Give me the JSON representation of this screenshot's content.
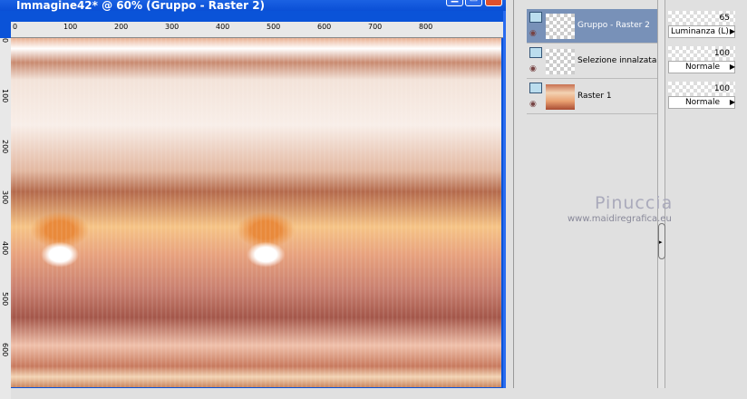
{
  "window": {
    "title": "Immagine42* @ 60% (Gruppo - Raster 2)",
    "minimize": "▁",
    "maximize": "□",
    "close": "✕"
  },
  "ruler": {
    "h_ticks": [
      "0",
      "100",
      "200",
      "300",
      "400",
      "500",
      "600",
      "700",
      "800"
    ],
    "v_ticks": [
      "0",
      "100",
      "200",
      "300",
      "400",
      "500",
      "600"
    ]
  },
  "layers": [
    {
      "name": "Gruppo - Raster 2",
      "selected": true,
      "opacity": "65",
      "blend": "Luminanza (L)"
    },
    {
      "name": "Selezione innalzata",
      "selected": false,
      "opacity": "100",
      "blend": "Normale"
    },
    {
      "name": "Raster 1",
      "selected": false,
      "opacity": "100",
      "blend": "Normale"
    }
  ],
  "watermark": {
    "name": "Pinuccia",
    "url": "www.maidiregrafica.eu"
  }
}
